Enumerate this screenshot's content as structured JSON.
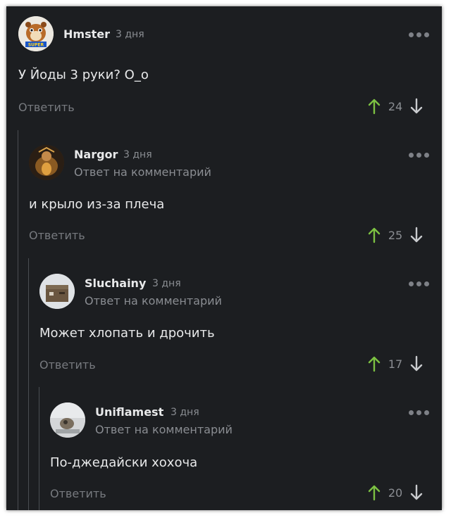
{
  "comments": [
    {
      "username": "Hmster",
      "time": "3 дня",
      "reply_note": "",
      "text": "У Йоды 3 руки? О_о",
      "reply_label": "Ответить",
      "score": "24",
      "avatar": "hamster-avatar"
    },
    {
      "username": "Nargor",
      "time": "3 дня",
      "reply_note": "Ответ на комментарий",
      "text": "и крыло из-за плеча",
      "reply_label": "Ответить",
      "score": "25",
      "avatar": "warrior-avatar"
    },
    {
      "username": "Sluchainy",
      "time": "3 дня",
      "reply_note": "Ответ на комментарий",
      "text": "Может хлопать и дрочить",
      "reply_label": "Ответить",
      "score": "17",
      "avatar": "box-avatar"
    },
    {
      "username": "Uniflamest",
      "time": "3 дня",
      "reply_note": "Ответ на комментарий",
      "text": "По-джедайски хохоча",
      "reply_label": "Ответить",
      "score": "20",
      "avatar": "photo-avatar"
    }
  ],
  "colors": {
    "background": "#1c1e21",
    "upvote": "#7cc142",
    "downvote": "#c9cbce",
    "text": "#e8e9ea",
    "muted": "#8a8d92"
  },
  "avatar_badge": "SUPER"
}
